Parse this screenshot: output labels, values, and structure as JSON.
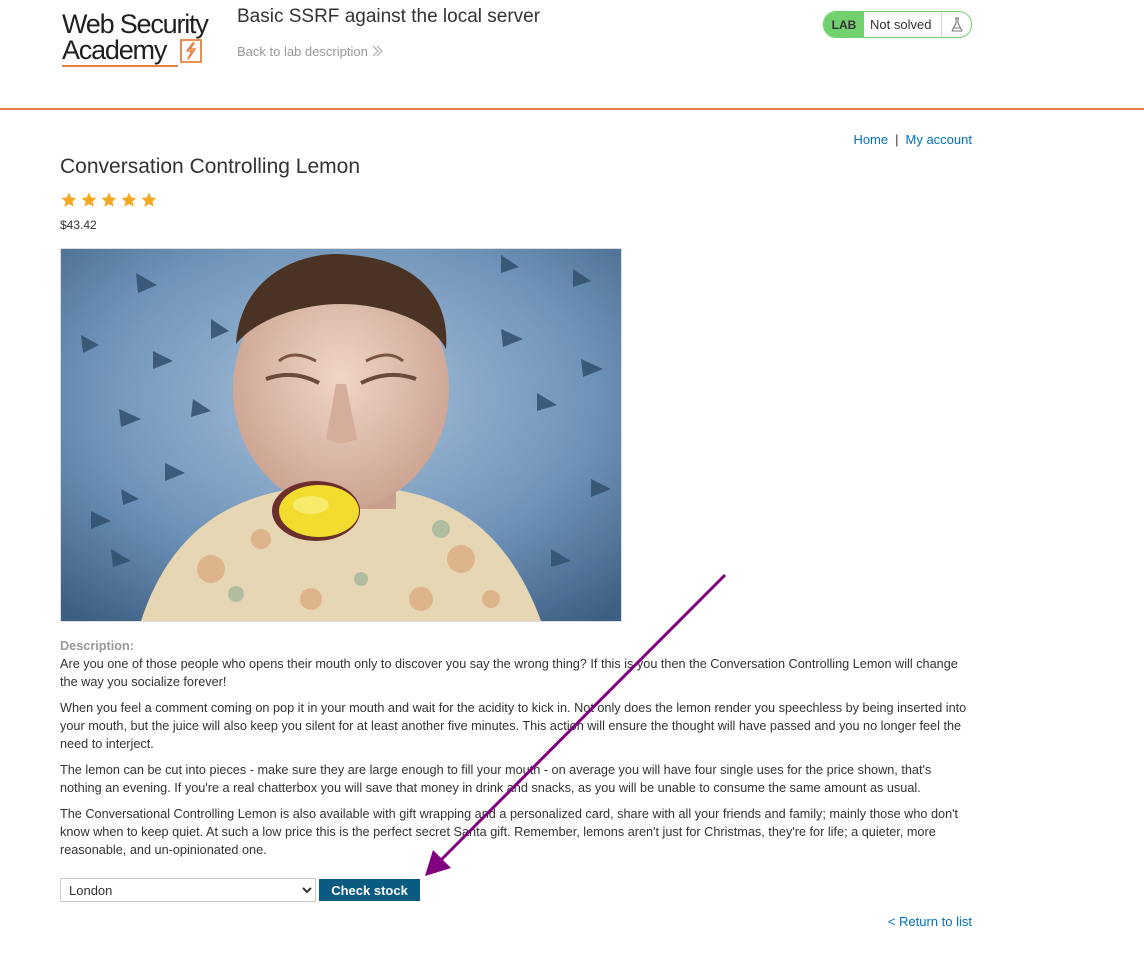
{
  "header": {
    "logo_line1": "Web Security",
    "logo_line2": "Academy",
    "lab_title": "Basic SSRF against the local server",
    "back_link": "Back to lab description",
    "lab_badge": {
      "label": "LAB",
      "status": "Not solved"
    }
  },
  "nav": {
    "home": "Home",
    "separator": "|",
    "account": "My account"
  },
  "product": {
    "title": "Conversation Controlling Lemon",
    "rating": 5,
    "rating_max": 5,
    "price": "$43.42",
    "description_label": "Description:",
    "paragraphs": [
      "Are you one of those people who opens their mouth only to discover you say the wrong thing? If this is you then the Conversation Controlling Lemon will change the way you socialize forever!",
      "When you feel a comment coming on pop it in your mouth and wait for the acidity to kick in. Not only does the lemon render you speechless by being inserted into your mouth, but the juice will also keep you silent for at least another five minutes. This action will ensure the thought will have passed and you no longer feel the need to interject.",
      "The lemon can be cut into pieces - make sure they are large enough to fill your mouth - on average you will have four single uses for the price shown, that's nothing an evening. If you're a real chatterbox you will save that money in drink and snacks, as you will be unable to consume the same amount as usual.",
      "The Conversational Controlling Lemon is also available with gift wrapping and a personalized card, share with all your friends and family; mainly those who don't know when to keep quiet. At such a low price this is the perfect secret Santa gift. Remember, lemons aren't just for Christmas, they're for life; a quieter, more reasonable, and un-opinionated one."
    ]
  },
  "stock": {
    "selected_location": "London",
    "button": "Check stock"
  },
  "return_link": "< Return to list",
  "icons": [
    "logo-lightning-icon",
    "chevron-right-icon",
    "flask-icon",
    "star-icon"
  ],
  "colors": {
    "accent_orange": "#e8803f",
    "lab_green": "#70d16d",
    "link_blue": "#0071bc",
    "button_blue": "#0a5a82",
    "star_gold": "#f6a821",
    "annotation_arrow": "#800080"
  }
}
